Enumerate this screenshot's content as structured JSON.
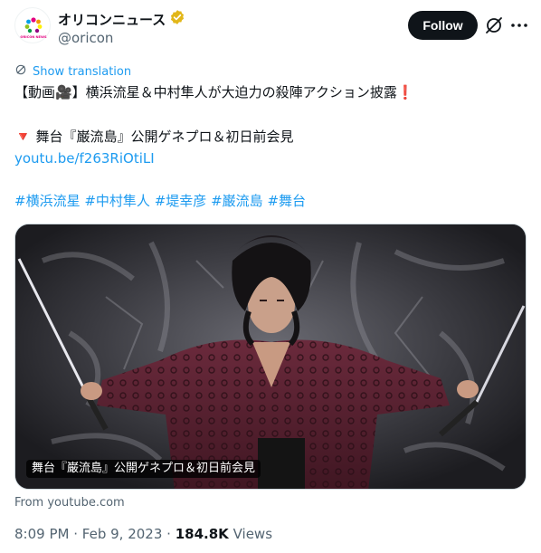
{
  "account": {
    "display_name": "オリコンニュース",
    "handle": "@oricon",
    "verified_badge": "gold-check-icon",
    "avatar_text": "ORICON NEWS"
  },
  "actions": {
    "follow_label": "Follow",
    "grok_icon": "grok-icon",
    "more_icon": "more-icon"
  },
  "translation": {
    "label": "Show translation"
  },
  "tweet": {
    "line1": "【動画🎥】横浜流星＆中村隼人が大迫力の殺陣アクション披露❗",
    "line2": "🔻 舞台『巌流島』公開ゲネプロ＆初日前会見",
    "link": "youtu.be/f263RiOtiLI",
    "hashtags": [
      "#横浜流星",
      "#中村隼人",
      "#堤幸彦",
      "#巌流島",
      "#舞台"
    ]
  },
  "card": {
    "caption": "舞台『巌流島』公開ゲネプロ＆初日前会見",
    "source": "From youtube.com"
  },
  "meta": {
    "time": "8:09 PM",
    "date": "Feb 9, 2023",
    "views_count": "184.8K",
    "views_label": "Views"
  },
  "colors": {
    "link": "#1d9bf0",
    "secondary_text": "#536471",
    "primary_text": "#0f1419",
    "badge_gold": "#e2b719"
  }
}
